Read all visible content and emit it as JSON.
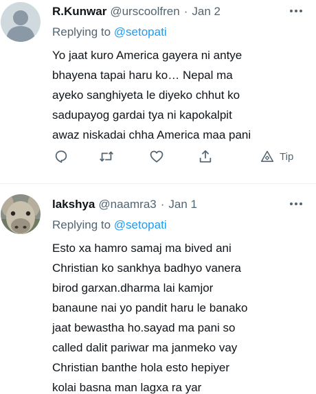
{
  "tweets": [
    {
      "author": "R.Kunwar",
      "handle": "@urscoolfren",
      "separator": "·",
      "date": "Jan 2",
      "replying_prefix": "Replying to",
      "replying_to": "@setopati",
      "text": "Yo jaat kuro America gayera ni antye\nbhayena tapai haru ko… Nepal ma\nayeko sanghiyeta le diyeko chhut ko\nsadupayog gardai tya ni kapokalpit\nawaz niskadai chha America maa pani",
      "tip_label": "Tip",
      "avatar_icon": "default-avatar-icon"
    },
    {
      "author": "lakshya",
      "handle": "@naamra3",
      "separator": "·",
      "date": "Jan 1",
      "replying_prefix": "Replying to",
      "replying_to": "@setopati",
      "text": "Esto xa hamro samaj ma bived ani\nChristian ko sankhya badhyo vanera\nbirod garxan.dharma lai kamjor\nbanaune nai yo pandit haru le banako\njaat bewastha ho.sayad ma pani so\ncalled dalit pariwar ma janmeko vay\nChristian banthe hola esto hepiyer\nkolai basna man lagxa ra yar",
      "avatar_icon": "donkey-photo-avatar"
    }
  ],
  "colors": {
    "text": "#0f1419",
    "secondary": "#536471",
    "link": "#1d9bf0",
    "divider": "#eff3f4"
  },
  "icons": [
    "more-icon",
    "reply-icon",
    "retweet-icon",
    "like-icon",
    "share-icon",
    "tip-icon"
  ]
}
